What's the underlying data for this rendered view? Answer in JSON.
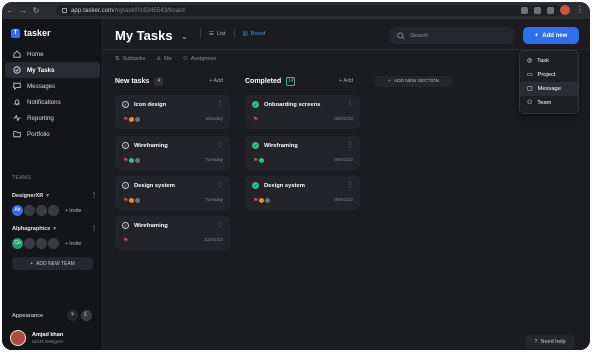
{
  "browser": {
    "url_host": "app.tasker.com",
    "url_path": "/mytask/016345543/board"
  },
  "app": {
    "logo_text": "tasker",
    "accent": "#2f6fec",
    "success": "#2ec27e"
  },
  "sidebar": {
    "items": [
      {
        "label": "Home",
        "icon": "home-icon"
      },
      {
        "label": "My Tasks",
        "icon": "check-circle-icon",
        "active": true
      },
      {
        "label": "Messages",
        "icon": "message-icon"
      },
      {
        "label": "Notifications",
        "icon": "bell-icon"
      },
      {
        "label": "Reporting",
        "icon": "activity-icon"
      },
      {
        "label": "Portfolio",
        "icon": "folder-icon"
      }
    ],
    "teams_heading": "TEAMS",
    "teams": [
      {
        "name": "DesignerXR",
        "first_member": "Ab",
        "invite": "+ Invite"
      },
      {
        "name": "Alphagraphics",
        "first_member": "Cn",
        "invite": "+ Invite"
      }
    ],
    "add_team_label": "ADD NEW TEAM",
    "appearance_label": "Appearance",
    "user": {
      "name": "Amjad khan",
      "role": "UI/UX Designer"
    }
  },
  "main": {
    "title": "My Tasks",
    "view_tabs": [
      {
        "label": "List",
        "icon": "list-icon"
      },
      {
        "label": "Board",
        "icon": "board-icon",
        "active": true
      }
    ],
    "search_placeholder": "Search",
    "add_new_label": "Add new",
    "filters": [
      {
        "label": "Subtasks",
        "icon": "subtask-icon"
      },
      {
        "label": "Me",
        "icon": "user-icon"
      },
      {
        "label": "Assignees",
        "icon": "users-icon"
      }
    ],
    "add_label": "+ Add",
    "add_section_label": "ADD NEW SECTION",
    "columns": [
      {
        "title": "New tasks",
        "count": "4",
        "cards": [
          {
            "title": "Icon design",
            "date": "Monday"
          },
          {
            "title": "Wireframing",
            "date": "Tuesday"
          },
          {
            "title": "Design system",
            "date": "Tuesday"
          },
          {
            "title": "Wireframing",
            "date": "12/01/22"
          }
        ]
      },
      {
        "title": "Completed",
        "count": "14",
        "cards": [
          {
            "title": "Onboarding screens",
            "date": "02/01/22"
          },
          {
            "title": "Wireframing",
            "date": "05/01/22"
          },
          {
            "title": "Design system",
            "date": "08/01/22"
          }
        ]
      }
    ]
  },
  "dropdown": {
    "items": [
      {
        "label": "Task",
        "icon": "check-circle-icon"
      },
      {
        "label": "Project",
        "icon": "folder-icon"
      },
      {
        "label": "Message",
        "icon": "message-icon",
        "hover": true
      },
      {
        "label": "Team",
        "icon": "users-icon"
      }
    ]
  },
  "help_label": "Need help"
}
